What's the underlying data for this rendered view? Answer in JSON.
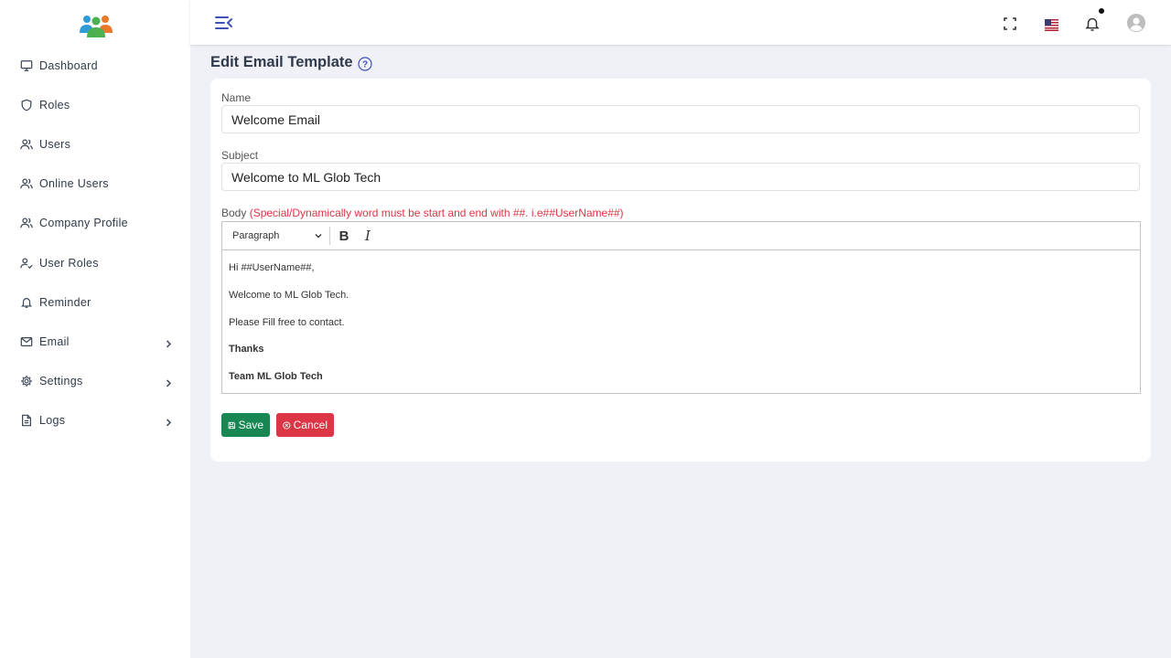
{
  "sidebar": {
    "items": [
      {
        "label": "Dashboard",
        "icon": "monitor-icon"
      },
      {
        "label": "Roles",
        "icon": "shield-icon"
      },
      {
        "label": "Users",
        "icon": "users-icon"
      },
      {
        "label": "Online Users",
        "icon": "users-icon"
      },
      {
        "label": "Company Profile",
        "icon": "users-icon"
      },
      {
        "label": "User Roles",
        "icon": "user-check-icon"
      },
      {
        "label": "Reminder",
        "icon": "bell-icon"
      },
      {
        "label": "Email",
        "icon": "mail-icon",
        "expandable": true
      },
      {
        "label": "Settings",
        "icon": "gear-icon",
        "expandable": true
      },
      {
        "label": "Logs",
        "icon": "file-icon",
        "expandable": true
      }
    ]
  },
  "header": {
    "icons": [
      "menu-collapse-icon",
      "fullscreen-icon",
      "us-flag-icon",
      "bell-icon",
      "avatar-icon"
    ]
  },
  "page": {
    "title": "Edit Email Template"
  },
  "form": {
    "name_label": "Name",
    "name_value": "Welcome Email",
    "subject_label": "Subject",
    "subject_value": "Welcome to ML Glob Tech",
    "body_label": "Body",
    "body_hint": "(Special/Dynamically word must be start and end with ##. i.e##UserName##)",
    "editor": {
      "block_format": "Paragraph",
      "bold": "B",
      "italic": "I",
      "lines": [
        {
          "text": "Hi ##UserName##,",
          "bold": false
        },
        {
          "text": "Welcome to ML Glob Tech.",
          "bold": false
        },
        {
          "text": "Please Fill free to contact.",
          "bold": false
        },
        {
          "text": "Thanks",
          "bold": true
        },
        {
          "text": "Team ML Glob Tech",
          "bold": true
        }
      ]
    },
    "save_label": "Save",
    "cancel_label": "Cancel"
  },
  "colors": {
    "accent": "#3f51b5",
    "save": "#198754",
    "cancel": "#dc3545",
    "hint": "#dc3545",
    "background": "#f0f1f7"
  }
}
